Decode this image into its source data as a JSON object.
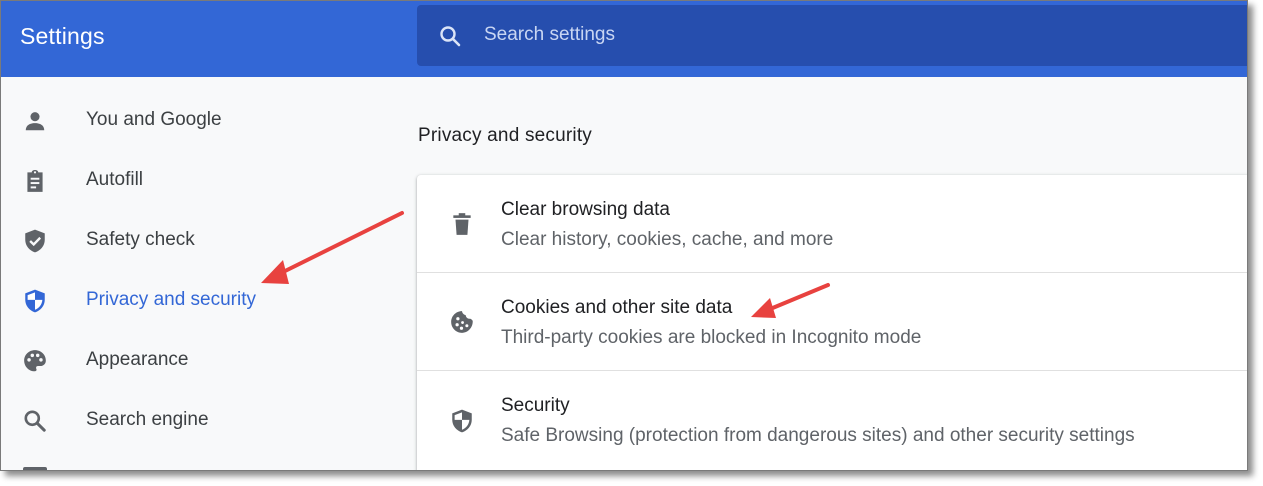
{
  "header": {
    "title": "Settings",
    "search": {
      "placeholder": "Search settings",
      "value": "",
      "icon": "search-icon"
    }
  },
  "sidebar": {
    "items": [
      {
        "label": "You and Google",
        "icon": "person-icon",
        "active": false
      },
      {
        "label": "Autofill",
        "icon": "clipboard-icon",
        "active": false
      },
      {
        "label": "Safety check",
        "icon": "shield-check-icon",
        "active": false
      },
      {
        "label": "Privacy and security",
        "icon": "shield-half-icon",
        "active": true
      },
      {
        "label": "Appearance",
        "icon": "palette-icon",
        "active": false
      },
      {
        "label": "Search engine",
        "icon": "search-icon",
        "active": false
      }
    ]
  },
  "main": {
    "section_title": "Privacy and security",
    "rows": [
      {
        "title": "Clear browsing data",
        "subtitle": "Clear history, cookies, cache, and more",
        "icon": "trash-icon"
      },
      {
        "title": "Cookies and other site data",
        "subtitle": "Third-party cookies are blocked in Incognito mode",
        "icon": "cookie-icon"
      },
      {
        "title": "Security",
        "subtitle": "Safe Browsing (protection from dangerous sites) and other security settings",
        "icon": "shield-half-icon"
      }
    ]
  },
  "colors": {
    "header": "#3367d6",
    "search_box": "#264eae",
    "active_item": "#3367d6",
    "annotation_arrow": "#e8423f"
  }
}
